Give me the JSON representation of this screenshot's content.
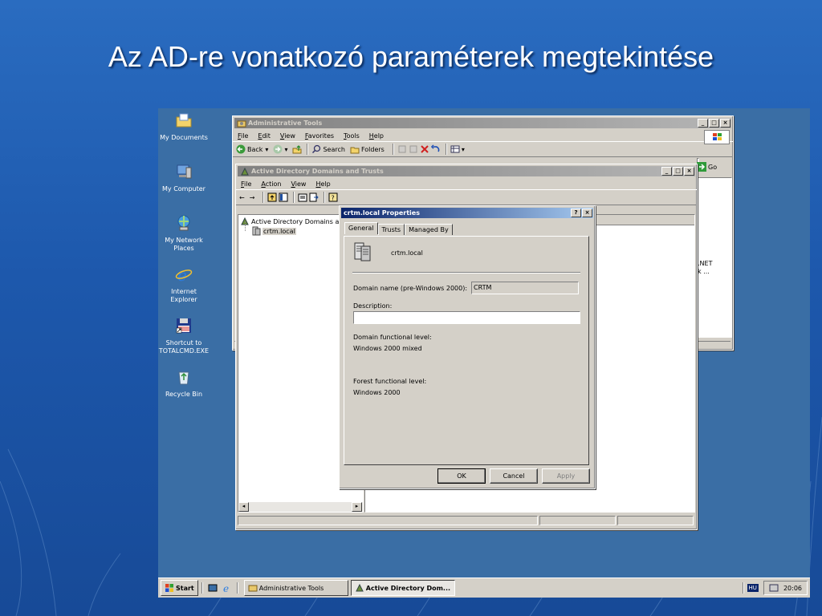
{
  "slide": {
    "title": "Az AD-re vonatkozó paraméterek megtekintése"
  },
  "desktop": {
    "icons": [
      {
        "label": "My Documents",
        "icon": "folder-documents-icon"
      },
      {
        "label": "My Computer",
        "icon": "computer-icon"
      },
      {
        "label": "My Network Places",
        "icon": "network-icon"
      },
      {
        "label": "Internet Explorer",
        "icon": "ie-icon"
      },
      {
        "label": "Shortcut to TOTALCMD.EXE",
        "icon": "floppy-icon"
      },
      {
        "label": "Recycle Bin",
        "icon": "recycle-bin-icon"
      }
    ]
  },
  "admin_tools": {
    "title": "Administrative Tools",
    "menu": [
      "File",
      "Edit",
      "View",
      "Favorites",
      "Tools",
      "Help"
    ],
    "toolbar": {
      "back": "Back",
      "search": "Search",
      "folders": "Folders"
    },
    "go": "Go",
    "peek_text": [
      ".NET",
      "k ..."
    ]
  },
  "ad_window": {
    "title": "Active Directory Domains and Trusts",
    "menu": [
      "File",
      "Action",
      "View",
      "Help"
    ],
    "tree": {
      "root": "Active Directory Domains an",
      "child": "crtm.local"
    }
  },
  "dialog": {
    "title": "crtm.local Properties",
    "help_btn": "?",
    "close_btn": "×",
    "tabs": [
      "General",
      "Trusts",
      "Managed By"
    ],
    "active_tab": "General",
    "domain_name": "crtm.local",
    "pre2000_label": "Domain name (pre-Windows 2000):",
    "pre2000_value": "CRTM",
    "description_label": "Description:",
    "description_value": "",
    "domain_level_label": "Domain functional level:",
    "domain_level_value": "Windows 2000 mixed",
    "forest_level_label": "Forest functional level:",
    "forest_level_value": "Windows 2000",
    "ok": "OK",
    "cancel": "Cancel",
    "apply": "Apply"
  },
  "taskbar": {
    "start": "Start",
    "tasks": [
      "Administrative Tools",
      "Active Directory Dom..."
    ],
    "lang": "HU",
    "clock": "20:06"
  }
}
